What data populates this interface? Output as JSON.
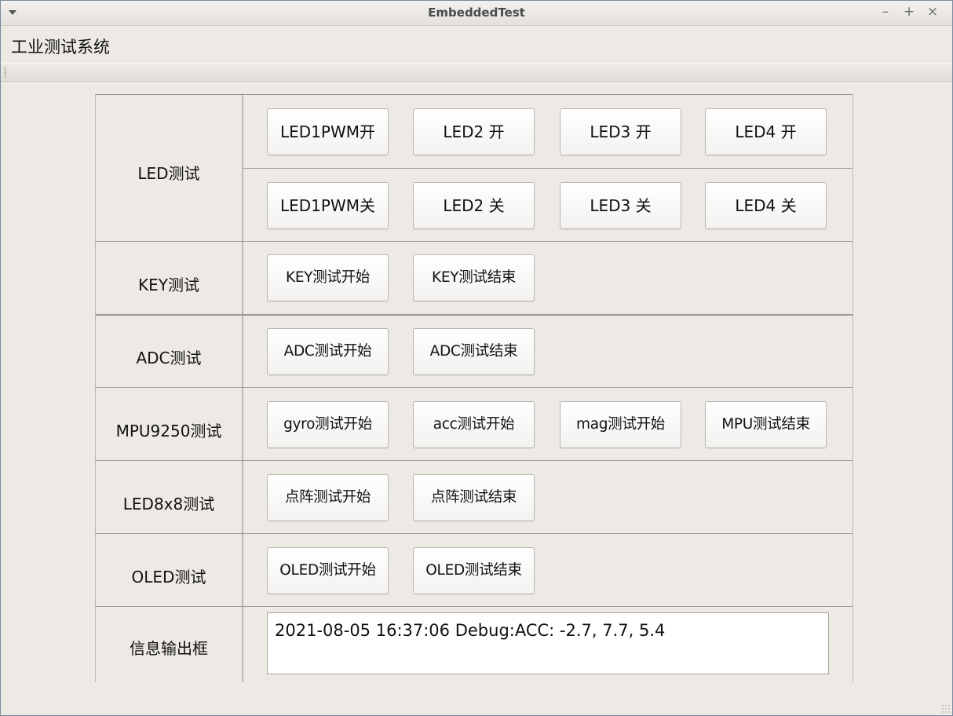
{
  "window": {
    "title": "EmbeddedTest",
    "controls": {
      "minimize": "–",
      "maximize": "+",
      "close": "×"
    }
  },
  "menubar": {
    "items": [
      "工业测试系统"
    ]
  },
  "rows": {
    "led": {
      "label": "LED测试",
      "on_buttons": [
        "LED1PWM开",
        "LED2 开",
        "LED3 开",
        "LED4 开"
      ],
      "off_buttons": [
        "LED1PWM关",
        "LED2 关",
        "LED3 关",
        "LED4 关"
      ]
    },
    "key": {
      "label": "KEY测试",
      "buttons": [
        "KEY测试开始",
        "KEY测试结束"
      ]
    },
    "adc": {
      "label": "ADC测试",
      "buttons": [
        "ADC测试开始",
        "ADC测试结束"
      ]
    },
    "mpu": {
      "label": "MPU9250测试",
      "buttons": [
        "gyro测试开始",
        "acc测试开始",
        "mag测试开始",
        "MPU测试结束"
      ]
    },
    "led8x8": {
      "label": "LED8x8测试",
      "buttons": [
        "点阵测试开始",
        "点阵测试结束"
      ]
    },
    "oled": {
      "label": "OLED测试",
      "buttons": [
        "OLED测试开始",
        "OLED测试结束"
      ]
    },
    "output": {
      "label": "信息输出框",
      "text": "2021-08-05 16:37:06 Debug:ACC: -2.7, 7.7, 5.4"
    }
  }
}
